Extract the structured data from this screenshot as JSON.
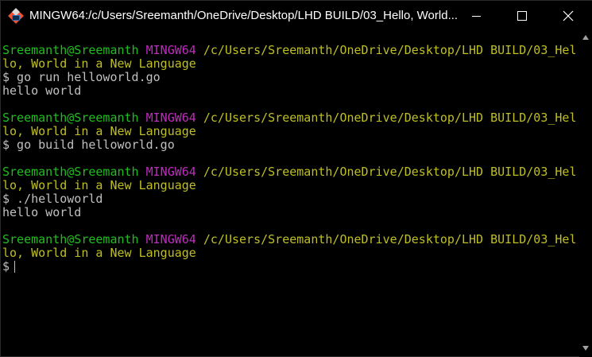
{
  "window": {
    "title": "MINGW64:/c/Users/Sreemanth/OneDrive/Desktop/LHD BUILD/03_Hello, World...",
    "icon": "git-bash-icon",
    "controls": {
      "minimize": "minimize-icon",
      "maximize": "maximize-icon",
      "close": "close-icon"
    }
  },
  "colors": {
    "background": "#000000",
    "user_host": "#1fbd1f",
    "shell": "#bf2bbf",
    "path": "#bfbf24",
    "text": "#c0c0c0"
  },
  "terminal": {
    "blocks": [
      {
        "user_host": "Sreemanth@Sreemanth",
        "shell": "MINGW64",
        "path_line1": "/c/Users/Sreemanth/OneDrive/Desktop/LHD BUILD/03_Hel",
        "path_line2": "lo, World in a New Language",
        "command": "$ go run helloworld.go",
        "output": "hello world"
      },
      {
        "user_host": "Sreemanth@Sreemanth",
        "shell": "MINGW64",
        "path_line1": "/c/Users/Sreemanth/OneDrive/Desktop/LHD BUILD/03_Hel",
        "path_line2": "lo, World in a New Language",
        "command": "$ go build helloworld.go",
        "output": ""
      },
      {
        "user_host": "Sreemanth@Sreemanth",
        "shell": "MINGW64",
        "path_line1": "/c/Users/Sreemanth/OneDrive/Desktop/LHD BUILD/03_Hel",
        "path_line2": "lo, World in a New Language",
        "command": "$ ./helloworld",
        "output": "hello world"
      },
      {
        "user_host": "Sreemanth@Sreemanth",
        "shell": "MINGW64",
        "path_line1": "/c/Users/Sreemanth/OneDrive/Desktop/LHD BUILD/03_Hel",
        "path_line2": "lo, World in a New Language",
        "prompt": "$"
      }
    ]
  }
}
